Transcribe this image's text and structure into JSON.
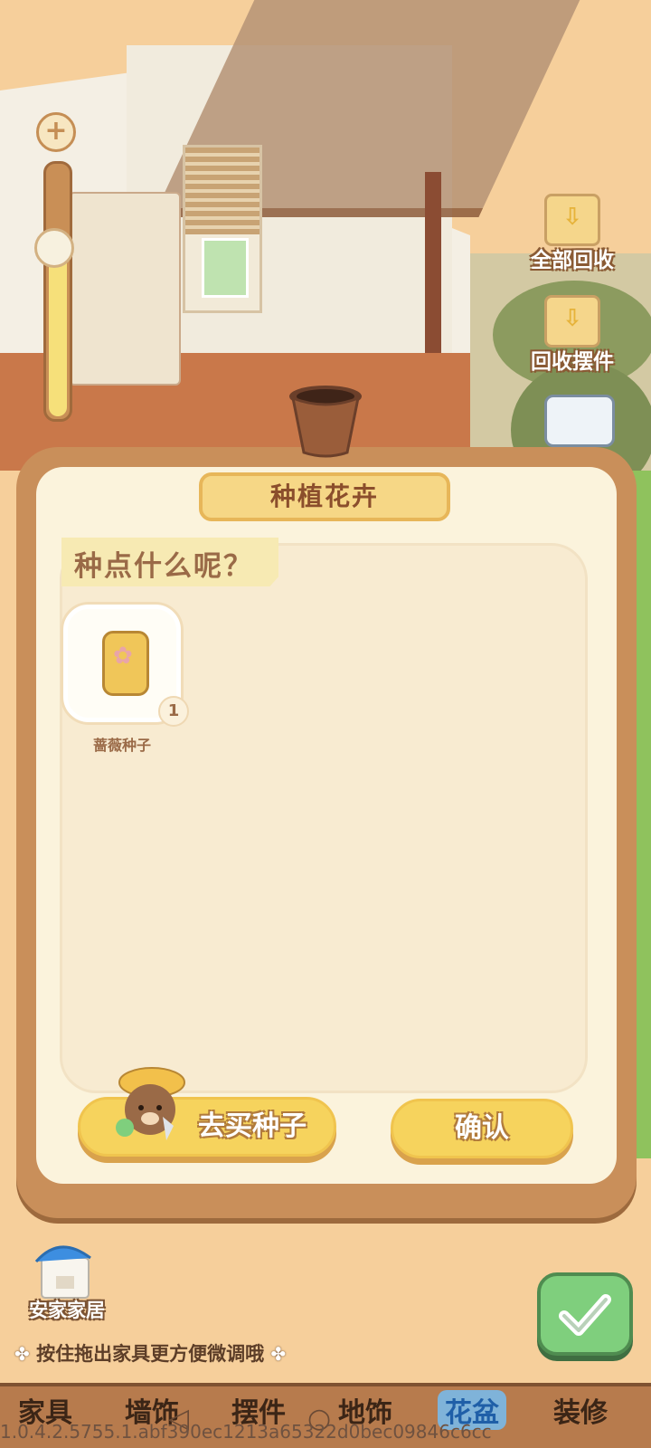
{
  "scene": {
    "zoom_plus_label": "+",
    "side_buttons": [
      {
        "label": "全部回收",
        "icon": "box-recycle-all-icon"
      },
      {
        "label": "回收摆件",
        "icon": "box-recycle-item-icon"
      },
      {
        "label": "",
        "icon": "truck-icon"
      }
    ]
  },
  "dialog": {
    "title": "种植花卉",
    "prompt": "种点什么呢？",
    "seeds": [
      {
        "name": "蔷薇种子",
        "count": "1",
        "icon": "seed-bag-icon"
      }
    ],
    "buy_seeds_button": "去买种子",
    "confirm_button": "确认"
  },
  "footer": {
    "home_label": "安家家居",
    "hint": "按住拖出家具更方便微调哦",
    "tabs": [
      {
        "label": "家具",
        "active": false
      },
      {
        "label": "墙饰",
        "active": false
      },
      {
        "label": "摆件",
        "active": false
      },
      {
        "label": "地饰",
        "active": false
      },
      {
        "label": "花盆",
        "active": true
      },
      {
        "label": "装修",
        "active": false
      }
    ],
    "version": "1.0.4.2.5755.1.abf390ec1213a65322d0bec09846c6cc"
  },
  "colors": {
    "dialog_frame": "#c98f5a",
    "dialog_bg": "#fbf3dc",
    "button_yellow": "#f6d35d",
    "confirm_green": "#7fcf7d",
    "active_tab": "#7fb3d9"
  }
}
